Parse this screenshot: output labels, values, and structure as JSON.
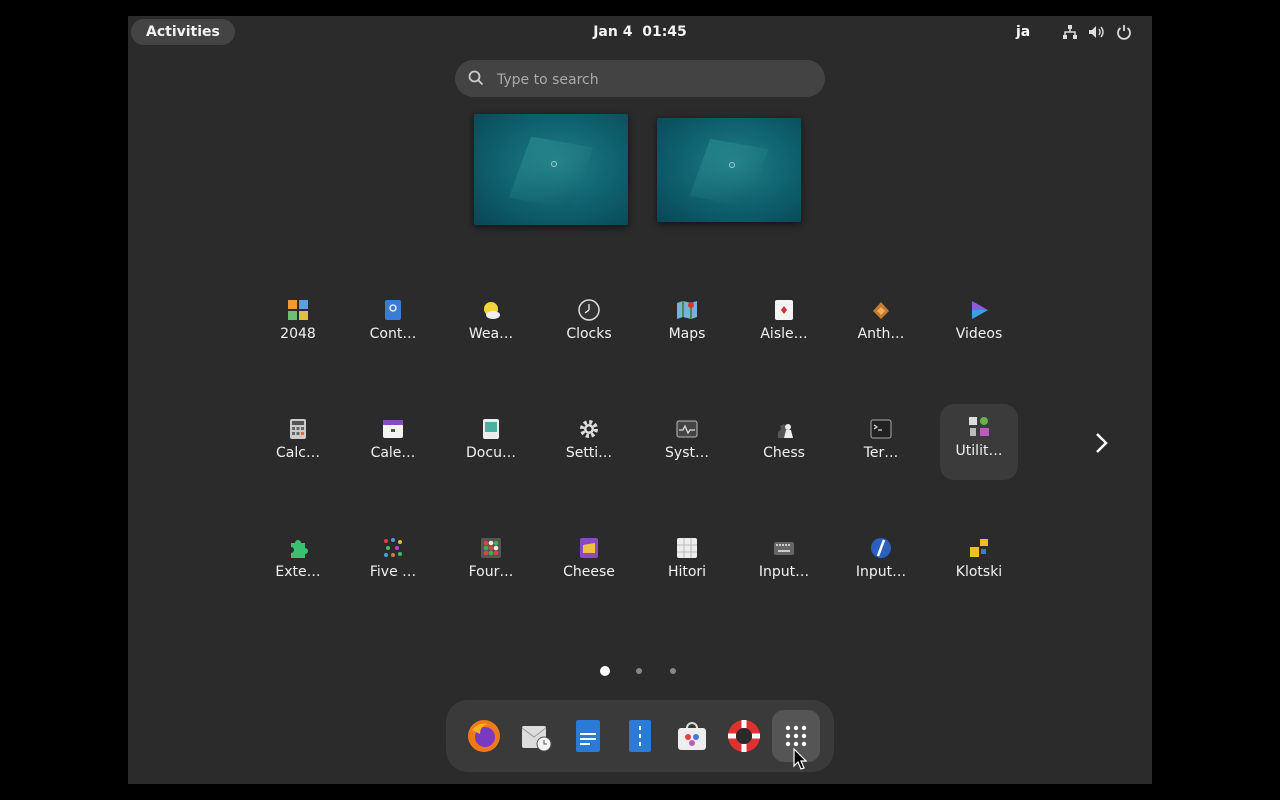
{
  "topbar": {
    "activities_label": "Activities",
    "datetime": "Jan 4  01:45",
    "input_method": "ja",
    "icons": [
      "network-icon",
      "volume-icon",
      "power-icon"
    ]
  },
  "search": {
    "placeholder": "Type to search"
  },
  "workspaces": [
    "workspace-1",
    "workspace-2"
  ],
  "apps_row1": [
    {
      "label": "2048",
      "icon": "game-2048-icon"
    },
    {
      "label": "Cont…",
      "icon": "contacts-icon"
    },
    {
      "label": "Wea…",
      "icon": "weather-icon"
    },
    {
      "label": "Clocks",
      "icon": "clocks-icon"
    },
    {
      "label": "Maps",
      "icon": "maps-icon"
    },
    {
      "label": "Aisle…",
      "icon": "aisleriot-icon"
    },
    {
      "label": "Anth…",
      "icon": "anthy-icon"
    },
    {
      "label": "Videos",
      "icon": "videos-icon"
    }
  ],
  "apps_row2": [
    {
      "label": "Calc…",
      "icon": "calculator-icon"
    },
    {
      "label": "Cale…",
      "icon": "calendar-icon"
    },
    {
      "label": "Docu…",
      "icon": "document-viewer-icon"
    },
    {
      "label": "Setti…",
      "icon": "settings-icon"
    },
    {
      "label": "Syst…",
      "icon": "system-monitor-icon"
    },
    {
      "label": "Chess",
      "icon": "chess-icon"
    },
    {
      "label": "Ter…",
      "icon": "terminal-icon"
    },
    {
      "label": "Utilit…",
      "icon": "utilities-folder-icon"
    }
  ],
  "apps_row3": [
    {
      "label": "Exte…",
      "icon": "extensions-icon"
    },
    {
      "label": "Five …",
      "icon": "five-or-more-icon"
    },
    {
      "label": "Four…",
      "icon": "four-in-a-row-icon"
    },
    {
      "label": "Cheese",
      "icon": "cheese-icon"
    },
    {
      "label": "Hitori",
      "icon": "hitori-icon"
    },
    {
      "label": "Input…",
      "icon": "input-method-icon"
    },
    {
      "label": "Input…",
      "icon": "input-method-panel-icon"
    },
    {
      "label": "Klotski",
      "icon": "klotski-icon"
    }
  ],
  "pagination": {
    "pages": 3,
    "current": 1
  },
  "dash": [
    "firefox-icon",
    "evolution-mail-icon",
    "writer-icon",
    "files-icon",
    "software-icon",
    "help-icon",
    "show-apps-icon"
  ],
  "colors": {
    "panel": "#2b2b2b",
    "accent": "#1f7d86"
  }
}
